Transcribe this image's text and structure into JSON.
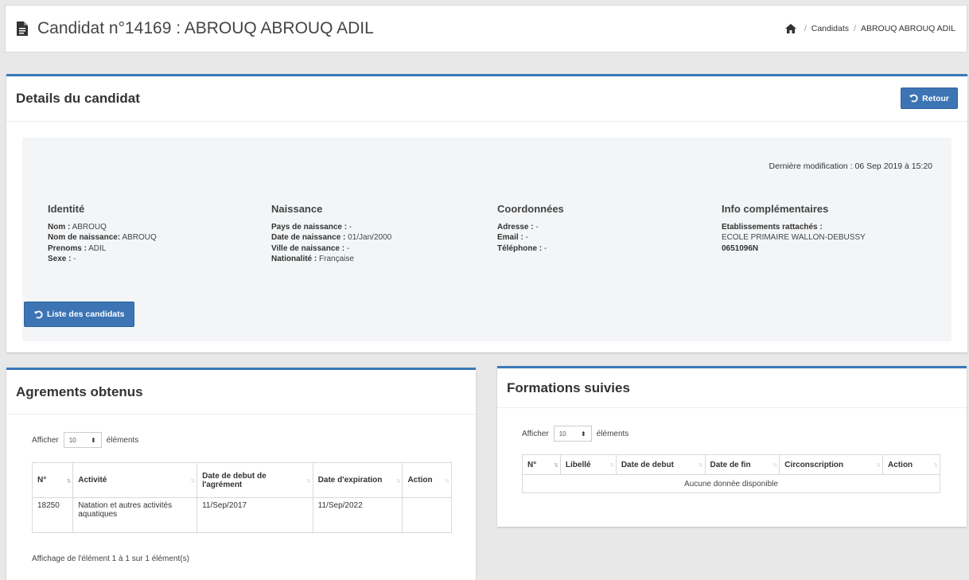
{
  "header": {
    "title": "Candidat n°14169 : ABROUQ ABROUQ ADIL",
    "title_icon": "file-icon",
    "breadcrumb": {
      "home_icon": "home-icon",
      "separator": "/",
      "items": [
        "Candidats",
        "ABROUQ ABROUQ ADIL"
      ]
    }
  },
  "details": {
    "title": "Details du candidat",
    "retour_label": "Retour",
    "last_modified": "Dernière modification : 06 Sep 2019 à 15:20",
    "identite": {
      "heading": "Identité",
      "fields": [
        {
          "label": "Nom :",
          "value": "ABROUQ"
        },
        {
          "label": "Nom de naissance:",
          "value": "ABROUQ"
        },
        {
          "label": "Prenoms :",
          "value": "ADIL"
        },
        {
          "label": "Sexe :",
          "value": "-"
        }
      ]
    },
    "naissance": {
      "heading": "Naissance",
      "fields": [
        {
          "label": "Pays de naissance :",
          "value": "-"
        },
        {
          "label": "Date de naissance :",
          "value": "01/Jan/2000"
        },
        {
          "label": "Ville de naissance :",
          "value": "-"
        },
        {
          "label": "Nationalité :",
          "value": "Française"
        }
      ]
    },
    "coordonnees": {
      "heading": "Coordonnées",
      "fields": [
        {
          "label": "Adresse :",
          "value": "-"
        },
        {
          "label": "Email :",
          "value": "-"
        },
        {
          "label": "Téléphone :",
          "value": "-"
        }
      ]
    },
    "info": {
      "heading": "Info complémentaires",
      "etab_label": "Etablissements rattachés :",
      "etab_name": "ECOLE PRIMAIRE WALLON-DEBUSSY",
      "etab_code": "0651096N"
    },
    "liste_label": "Liste des candidats"
  },
  "agrements": {
    "title": "Agrements obtenus",
    "afficher": "Afficher",
    "page_size": "10",
    "elements": "éléments",
    "columns": [
      "N°",
      "Activité",
      "Date de debut de l'agrément",
      "Date d'expiration",
      "Action"
    ],
    "rows": [
      {
        "n": "18250",
        "activite": "Natation et autres activités aquatiques",
        "debut": "11/Sep/2017",
        "expiration": "11/Sep/2022",
        "action": ""
      }
    ],
    "info": "Affichage de l'élément 1 à 1 sur 1 élément(s)"
  },
  "formations": {
    "title": "Formations suivies",
    "afficher": "Afficher",
    "page_size": "10",
    "elements": "éléments",
    "columns": [
      "N°",
      "Libellé",
      "Date de debut",
      "Date de fin",
      "Circonscription",
      "Action"
    ],
    "empty": "Aucune donnée disponible"
  },
  "colors": {
    "accent": "#3c78b8",
    "button": "#3c74b4"
  }
}
